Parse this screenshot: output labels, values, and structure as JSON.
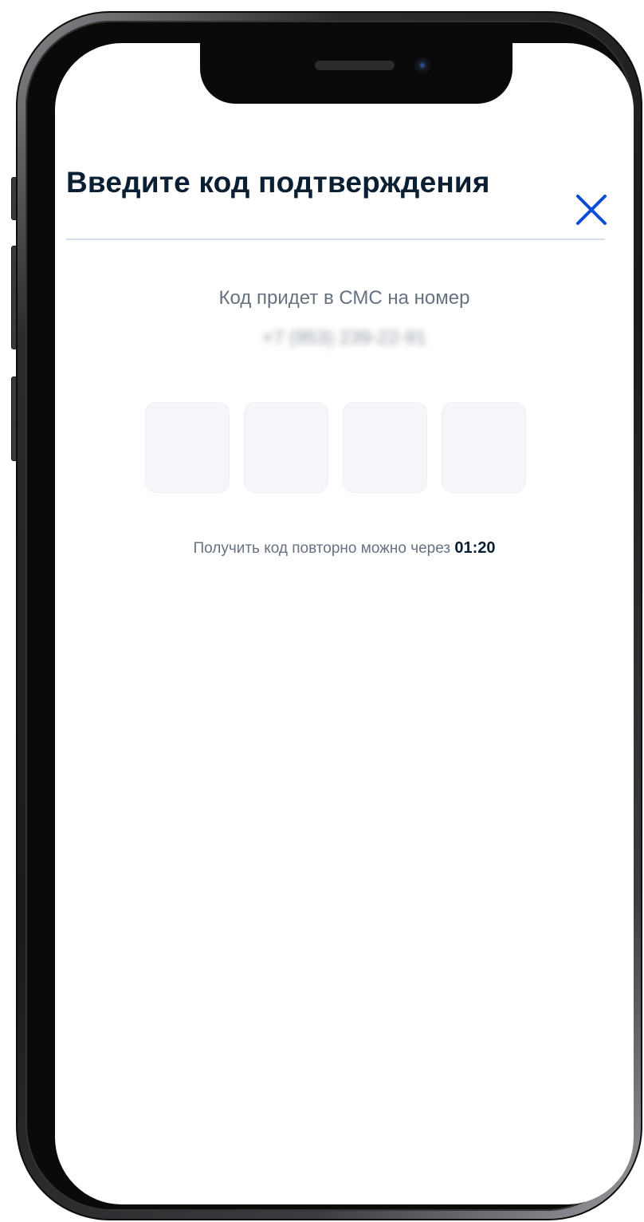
{
  "screen": {
    "title": "Введите код подтверждения",
    "close_icon": "close-icon",
    "sms_hint": "Код придет в СМС на номер",
    "phone_number": "+7 (953) 239-22-91",
    "code_inputs": [
      {
        "value": ""
      },
      {
        "value": ""
      },
      {
        "value": ""
      },
      {
        "value": ""
      }
    ],
    "resend_text": "Получить код повторно можно через",
    "resend_timer": "01:20"
  },
  "colors": {
    "title": "#0b1f33",
    "accent": "#0d4cd3",
    "muted_text": "#66727f",
    "divider": "#d5deeb",
    "input_bg": "#f4f6fa"
  }
}
